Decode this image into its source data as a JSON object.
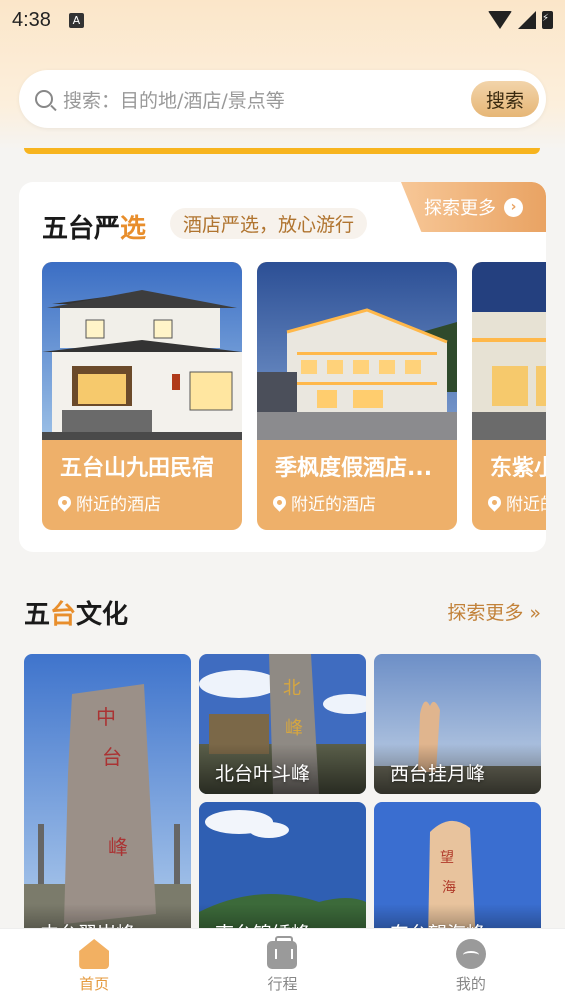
{
  "status_bar": {
    "time": "4:38",
    "badge": "A"
  },
  "search": {
    "placeholder": "搜索：目的地/酒店/景点等",
    "button": "搜索"
  },
  "selection": {
    "title_main": "五台严",
    "title_accent": "选",
    "subtitle": "酒店严选，放心游行",
    "more": "探索更多",
    "hotels": [
      {
        "name": "五台山九田民宿",
        "location": "附近的酒店"
      },
      {
        "name": "季枫度假酒店...",
        "location": "附近的酒店"
      },
      {
        "name": "东紫小",
        "location": "附近的"
      }
    ]
  },
  "culture": {
    "title_part1": "五",
    "title_accent": "台",
    "title_part2": "文化",
    "more": "探索更多 »",
    "tiles": [
      {
        "label": "中台翠岩峰"
      },
      {
        "label": "北台叶斗峰"
      },
      {
        "label": "西台挂月峰"
      },
      {
        "label": "南台锦绣峰"
      },
      {
        "label": "东台望海峰"
      }
    ]
  },
  "bottom_nav": [
    {
      "label": "首页",
      "icon": "home-icon",
      "active": true
    },
    {
      "label": "行程",
      "icon": "trip-icon",
      "active": false
    },
    {
      "label": "我的",
      "icon": "me-icon",
      "active": false
    }
  ],
  "colors": {
    "accent": "#e88e2c",
    "nav_active": "#e59a3e",
    "highlight_line": "#f7b41f"
  }
}
